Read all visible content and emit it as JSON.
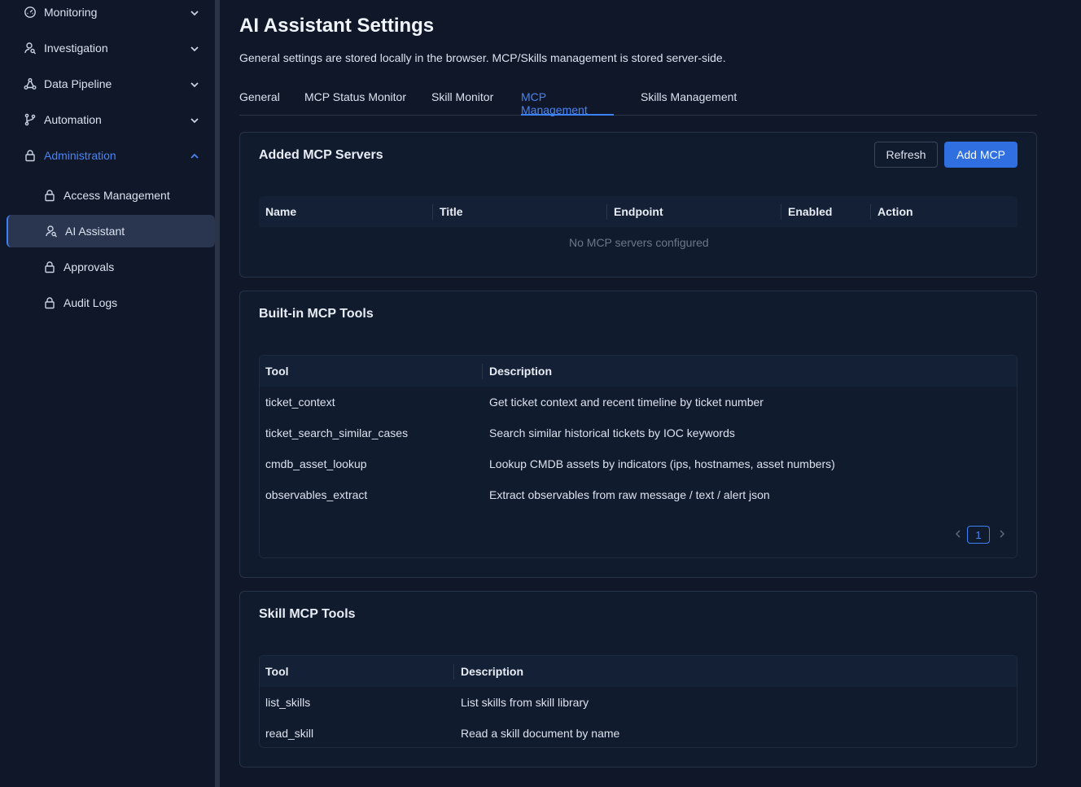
{
  "sidebar": {
    "groups": [
      {
        "label": "Monitoring",
        "icon": "gauge-icon"
      },
      {
        "label": "Investigation",
        "icon": "user-search-icon"
      },
      {
        "label": "Data Pipeline",
        "icon": "share-nodes-icon"
      },
      {
        "label": "Automation",
        "icon": "git-branch-icon"
      },
      {
        "label": "Administration",
        "icon": "lock-icon"
      }
    ],
    "sub_items": [
      {
        "label": "Access Management",
        "icon": "lock-icon"
      },
      {
        "label": "AI Assistant",
        "icon": "user-search-icon"
      },
      {
        "label": "Approvals",
        "icon": "lock-icon"
      },
      {
        "label": "Audit Logs",
        "icon": "lock-icon"
      }
    ]
  },
  "page": {
    "title": "AI Assistant Settings",
    "subtitle": "General settings are stored locally in the browser. MCP/Skills management is stored server-side."
  },
  "tabs": [
    "General",
    "MCP Status Monitor",
    "Skill Monitor",
    "MCP Management",
    "Skills Management"
  ],
  "active_tab": "MCP Management",
  "added_servers": {
    "title": "Added MCP Servers",
    "refresh_label": "Refresh",
    "add_label": "Add MCP",
    "columns": [
      "Name",
      "Title",
      "Endpoint",
      "Enabled",
      "Action"
    ],
    "empty_text": "No MCP servers configured"
  },
  "builtin_tools": {
    "title": "Built-in MCP Tools",
    "columns": [
      "Tool",
      "Description"
    ],
    "rows": [
      {
        "tool": "ticket_context",
        "description": "Get ticket context and recent timeline by ticket number"
      },
      {
        "tool": "ticket_search_similar_cases",
        "description": "Search similar historical tickets by IOC keywords"
      },
      {
        "tool": "cmdb_asset_lookup",
        "description": "Lookup CMDB assets by indicators (ips, hostnames, asset numbers)"
      },
      {
        "tool": "observables_extract",
        "description": "Extract observables from raw message / text / alert json"
      }
    ],
    "pagination": {
      "current_page": "1"
    }
  },
  "skill_tools": {
    "title": "Skill MCP Tools",
    "columns": [
      "Tool",
      "Description"
    ],
    "rows": [
      {
        "tool": "list_skills",
        "description": "List skills from skill library"
      },
      {
        "tool": "read_skill",
        "description": "Read a skill document by name"
      }
    ]
  },
  "colors": {
    "background": "#0f1729",
    "accent": "#3b82f6",
    "card": "#111b2e",
    "primary_button": "#2f6fe0"
  }
}
